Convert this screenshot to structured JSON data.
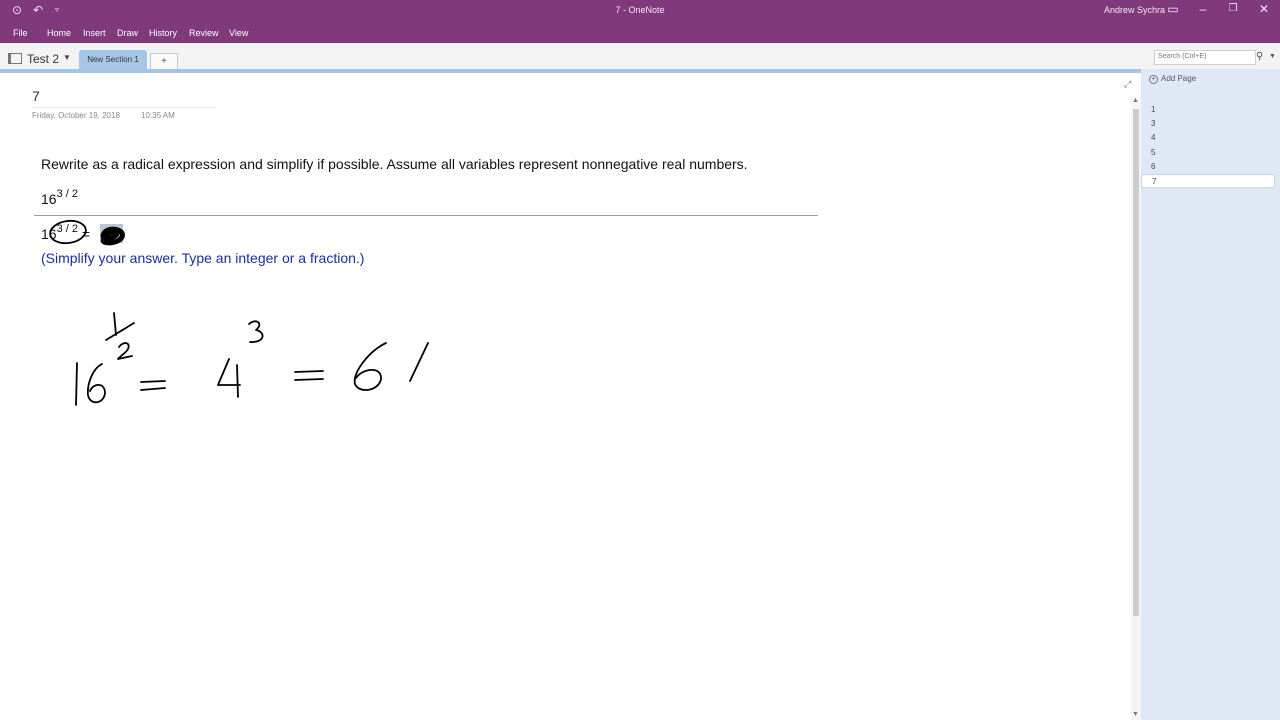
{
  "window": {
    "title": "7 - OneNote",
    "user": "Andrew Sychra"
  },
  "ribbon": {
    "tabs": [
      "File",
      "Home",
      "Insert",
      "Draw",
      "History",
      "Review",
      "View"
    ]
  },
  "notebook": {
    "name": "Test 2",
    "section": "New Section 1",
    "add_section": "+"
  },
  "search": {
    "placeholder": "Search (Ctrl+E)"
  },
  "page": {
    "title": "7",
    "date": "Friday, October 19, 2018",
    "time": "10:35 AM",
    "question": "Rewrite as a radical expression and simplify if possible. Assume all variables represent nonnegative real numbers.",
    "expr_base": "16",
    "expr_exp": "3 / 2",
    "answer_base": "16",
    "answer_exp": "3 / 2",
    "answer_eq": "=",
    "hint": "(Simplify your answer. Type an integer or a fraction.)"
  },
  "pages_panel": {
    "add_label": "Add Page",
    "items": [
      "1",
      "3",
      "4",
      "5",
      "6",
      "7"
    ],
    "selected": "7"
  },
  "colors": {
    "title_bar": "#80397b",
    "section_tab": "#a7c6e6",
    "hint_text": "#1a2ea0",
    "page_panel": "#dfe9f5"
  }
}
